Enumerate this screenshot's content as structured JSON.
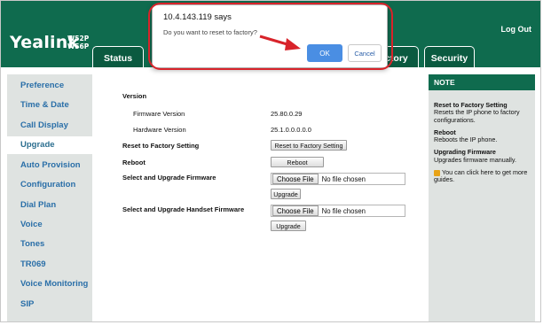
{
  "header": {
    "logo": "Yealink",
    "model_line1": "W52P",
    "model_line2": "W56P",
    "logout": "Log Out",
    "tabs": {
      "status": "Status",
      "directory": "ectory",
      "security": "Security"
    }
  },
  "sidebar": {
    "items": [
      "Preference",
      "Time & Date",
      "Call Display",
      "Upgrade",
      "Auto Provision",
      "Configuration",
      "Dial Plan",
      "Voice",
      "Tones",
      "TR069",
      "Voice Monitoring",
      "SIP"
    ],
    "active": "Upgrade"
  },
  "main": {
    "version_label": "Version",
    "firmware_label": "Firmware Version",
    "firmware_value": "25.80.0.29",
    "hardware_label": "Hardware Version",
    "hardware_value": "25.1.0.0.0.0.0",
    "reset_label": "Reset to Factory Setting",
    "reset_button": "Reset to Factory Setting",
    "reboot_label": "Reboot",
    "reboot_button": "Reboot",
    "upgrade_fw_label": "Select and Upgrade Firmware",
    "upgrade_handset_label": "Select and Upgrade Handset Firmware",
    "choose_file": "Choose File",
    "no_file": "No file chosen",
    "upgrade_button": "Upgrade"
  },
  "note": {
    "title": "NOTE",
    "reset_title": "Reset to Factory Setting",
    "reset_text": "Resets the IP phone to factory configurations.",
    "reboot_title": "Reboot",
    "reboot_text": "Reboots the IP phone.",
    "upgrade_title": "Upgrading Firmware",
    "upgrade_text": "Upgrades firmware manually.",
    "guide_text": "You can click here to get more guides."
  },
  "dialog": {
    "title": "10.4.143.119 says",
    "message": "Do you want to reset to factory?",
    "ok": "OK",
    "cancel": "Cancel"
  },
  "colors": {
    "brand_green": "#0f6b4e",
    "link_blue": "#2a6fa8",
    "ok_blue": "#4a8ee3",
    "highlight_red": "#d8232a"
  }
}
